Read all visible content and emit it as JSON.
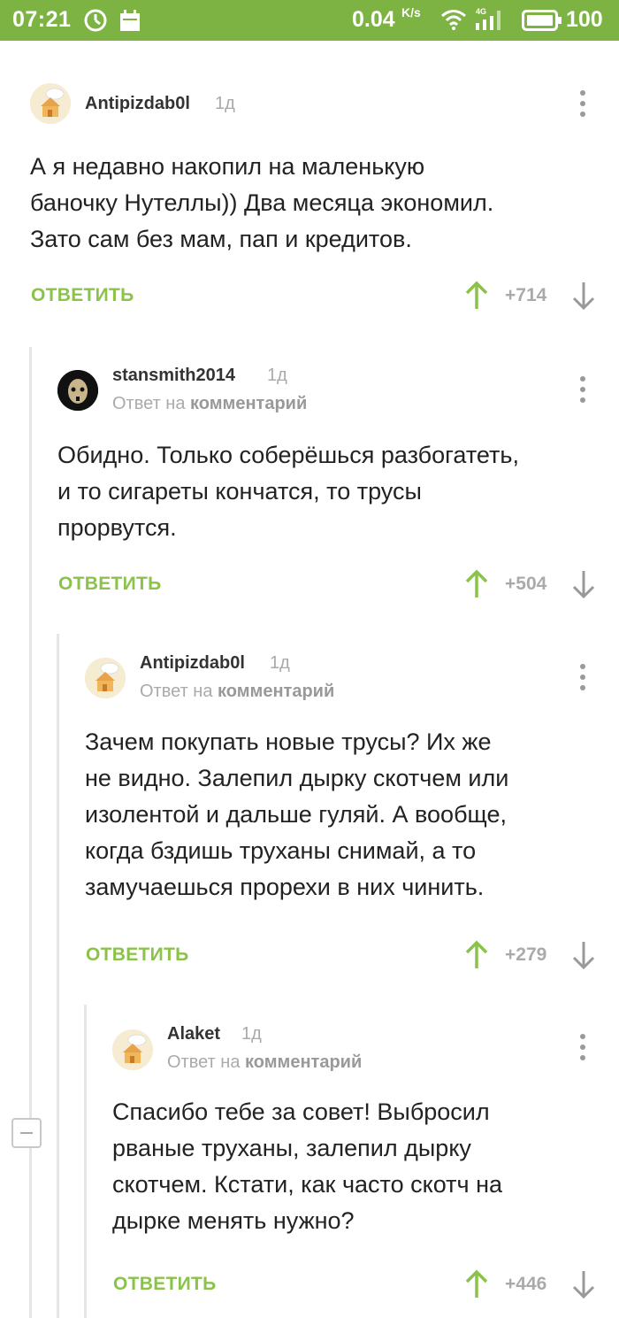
{
  "status_bar": {
    "time": "07:21",
    "net_speed": "0.04",
    "net_speed_unit": "K/s",
    "network_type": "4G",
    "battery": "100",
    "icons": [
      "alarm-icon",
      "calendar-icon",
      "wifi-icon",
      "signal-icon",
      "battery-icon"
    ]
  },
  "colors": {
    "accent": "#8bc34a",
    "status_bar": "#7cb342",
    "muted": "#aaaaaa"
  },
  "comments": [
    {
      "username": "Antipizdab0l",
      "age": "1д",
      "reply_prefix": "",
      "reply_target": "",
      "text_lines": [
        "А я недавно накопил на маленькую",
        "баночку Нутеллы)) Два месяца экономил.",
        "Зато сам без мам, пап и кредитов."
      ],
      "reply_label": "ОТВЕТИТЬ",
      "score": "+714"
    },
    {
      "username": "stansmith2014",
      "age": "1д",
      "reply_prefix": "Ответ на",
      "reply_target": "комментарий",
      "text_lines": [
        "Обидно. Только соберёшься разбогатеть,",
        "и то сигареты кончатся, то трусы",
        "прорвутся."
      ],
      "reply_label": "ОТВЕТИТЬ",
      "score": "+504"
    },
    {
      "username": "Antipizdab0l",
      "age": "1д",
      "reply_prefix": "Ответ на",
      "reply_target": "комментарий",
      "text_lines": [
        "Зачем покупать новые трусы? Их же",
        "не видно. Залепил дырку скотчем или",
        "изолентой и дальше гуляй. А вообще,",
        "когда бздишь труханы снимай, а то",
        "замучаешься прорехи в них чинить."
      ],
      "reply_label": "ОТВЕТИТЬ",
      "score": "+279"
    },
    {
      "username": "Alaket",
      "age": "1д",
      "reply_prefix": "Ответ на",
      "reply_target": "комментарий",
      "text_lines": [
        "Спасибо тебе за совет! Выбросил",
        "рваные труханы, залепил дырку",
        "скотчем. Кстати, как часто скотч на",
        "дырке менять нужно?"
      ],
      "reply_label": "ОТВЕТИТЬ",
      "score": "+446"
    }
  ]
}
